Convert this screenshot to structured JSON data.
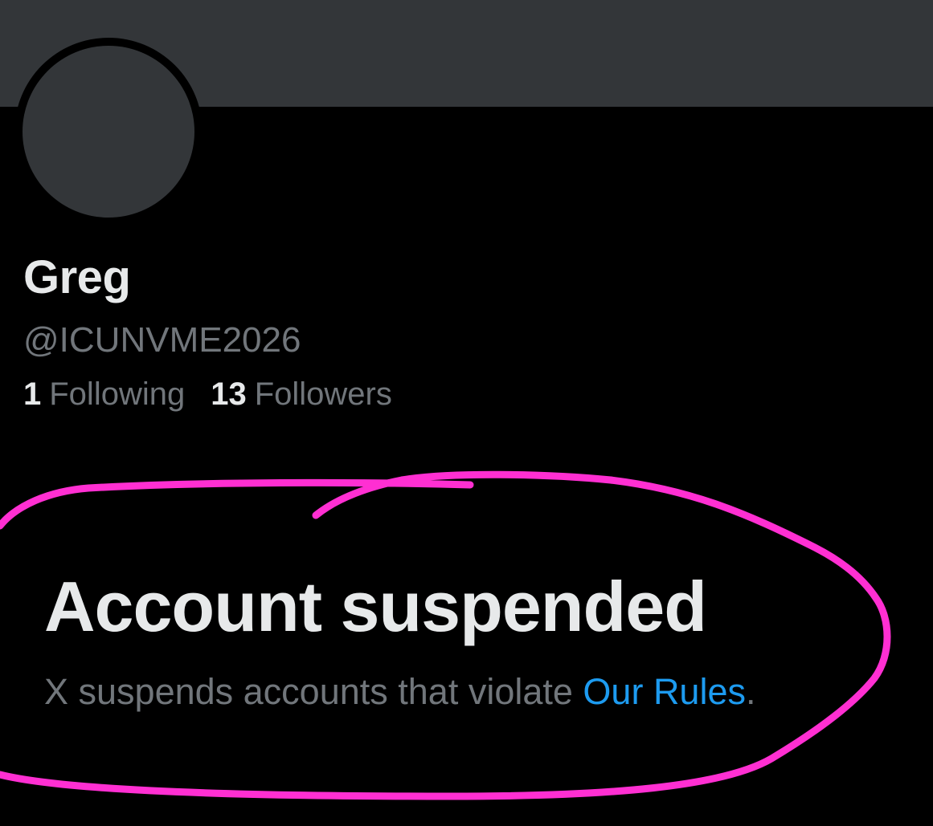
{
  "profile": {
    "display_name": "Greg",
    "handle": "@ICUNVME2026",
    "following_count": "1",
    "following_label": "Following",
    "followers_count": "13",
    "followers_label": "Followers"
  },
  "notice": {
    "title": "Account suspended",
    "text": "X suspends accounts that violate ",
    "link_label": "Our Rules",
    "trailing": "."
  },
  "colors": {
    "background": "#000000",
    "banner": "#333639",
    "primary_text": "#e7e9ea",
    "secondary_text": "#71767b",
    "link": "#1d9bf0",
    "annotation_marker": "#ff2fd2"
  }
}
